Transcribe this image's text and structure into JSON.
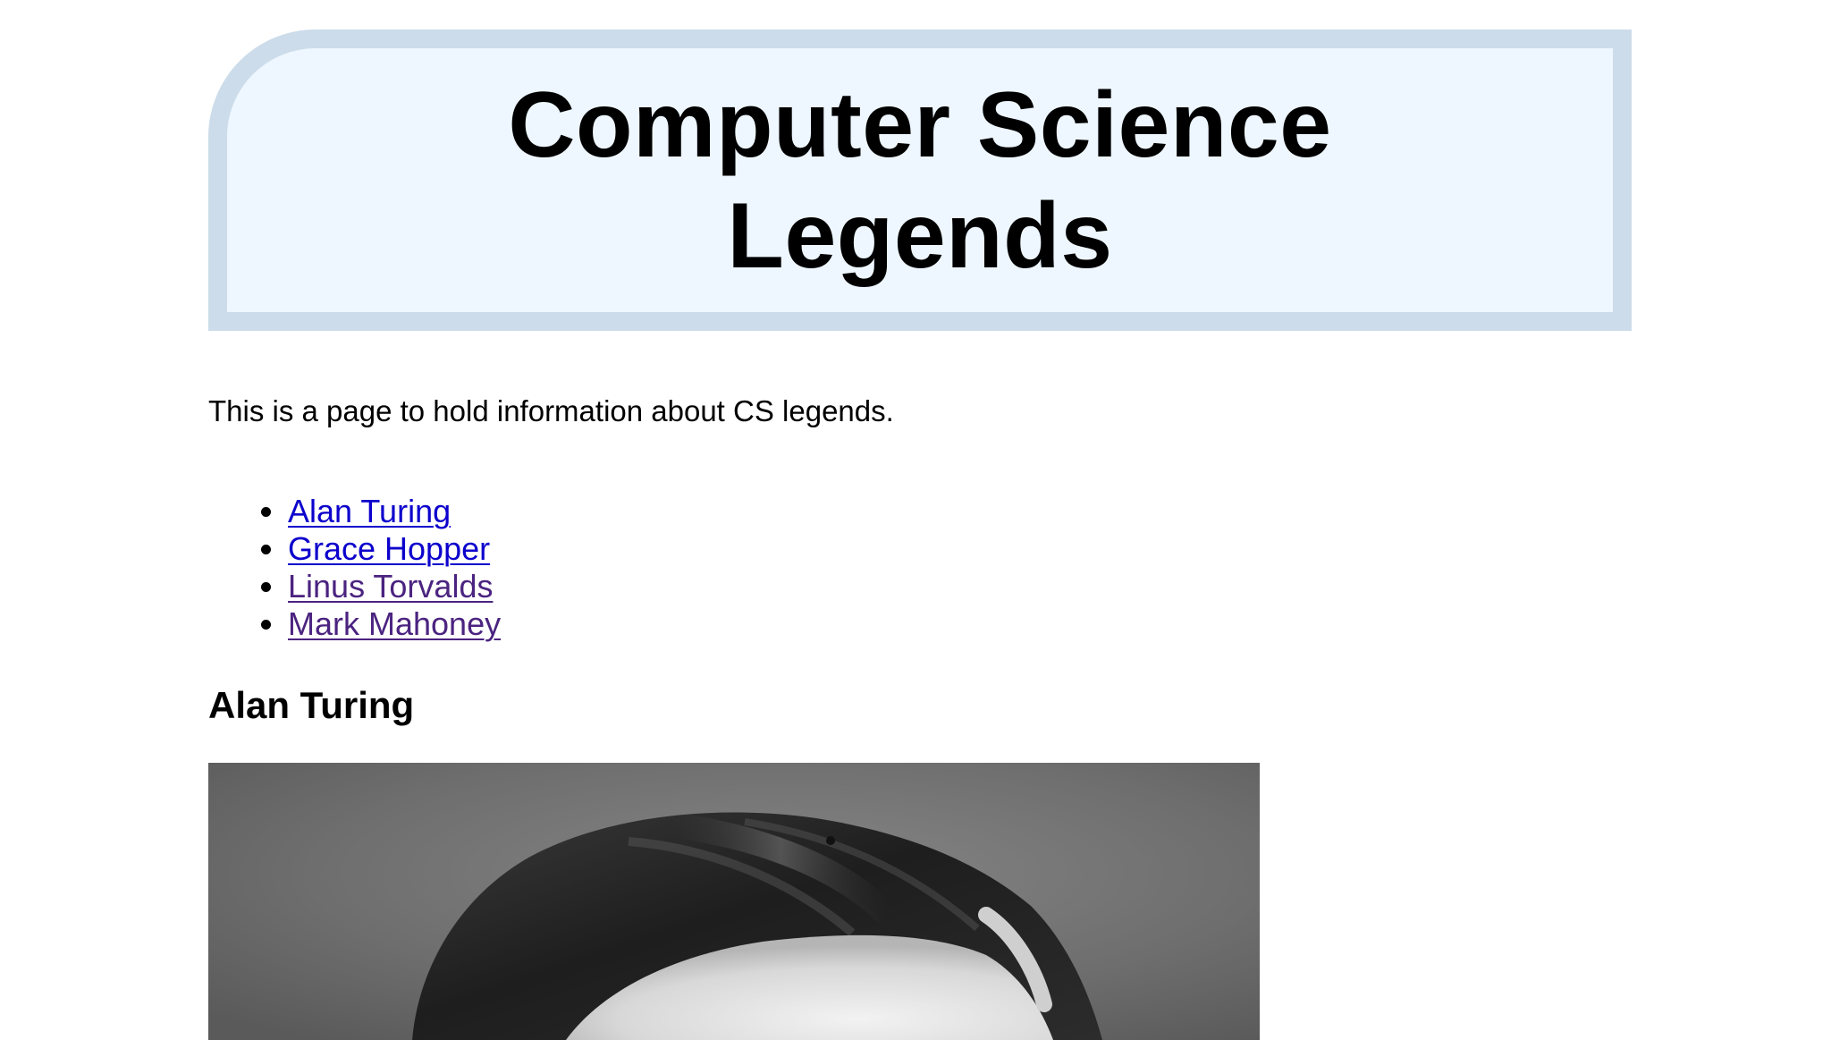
{
  "header": {
    "title": "Computer Science Legends"
  },
  "intro": {
    "text": "This is a page to hold information about CS legends."
  },
  "legends": {
    "items": [
      {
        "label": "Alan Turing",
        "state": "unvisited"
      },
      {
        "label": "Grace Hopper",
        "state": "unvisited"
      },
      {
        "label": "Linus Torvalds",
        "state": "visited"
      },
      {
        "label": "Mark Mahoney",
        "state": "visited"
      }
    ]
  },
  "sections": {
    "first_heading": "Alan Turing"
  },
  "colors": {
    "banner_background": "#eef7ff",
    "banner_border": "#ccdcea",
    "link_unvisited": "#0c00cc",
    "link_visited": "#4b2380"
  },
  "icons": {
    "bullet": "bullet-dot-icon"
  }
}
